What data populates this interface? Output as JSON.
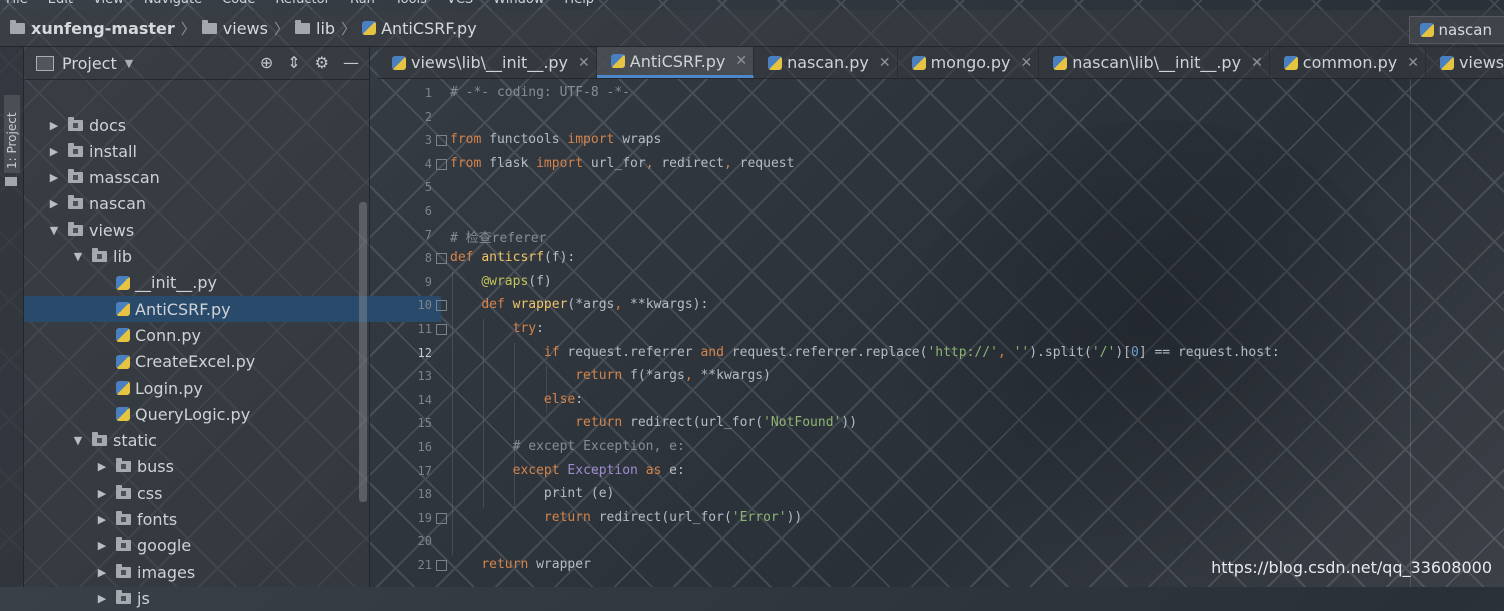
{
  "menu": [
    "File",
    "Edit",
    "View",
    "Navigate",
    "Code",
    "Refactor",
    "Run",
    "Tools",
    "VCS",
    "Window",
    "Help"
  ],
  "breadcrumb": [
    "xunfeng-master",
    "views",
    "lib",
    "AntiCSRF.py"
  ],
  "run_config": "nascan",
  "toolwindow_label": "1: Project",
  "project_panel": {
    "title": "Project"
  },
  "tree": [
    {
      "label": "docs",
      "type": "folder",
      "depth": 1,
      "state": "collapsed"
    },
    {
      "label": "install",
      "type": "folder",
      "depth": 1,
      "state": "collapsed"
    },
    {
      "label": "masscan",
      "type": "folder",
      "depth": 1,
      "state": "collapsed"
    },
    {
      "label": "nascan",
      "type": "folder",
      "depth": 1,
      "state": "collapsed"
    },
    {
      "label": "views",
      "type": "folder",
      "depth": 1,
      "state": "expanded"
    },
    {
      "label": "lib",
      "type": "folder",
      "depth": 2,
      "state": "expanded"
    },
    {
      "label": "__init__.py",
      "type": "file",
      "depth": 3
    },
    {
      "label": "AntiCSRF.py",
      "type": "file",
      "depth": 3,
      "selected": true
    },
    {
      "label": "Conn.py",
      "type": "file",
      "depth": 3
    },
    {
      "label": "CreateExcel.py",
      "type": "file",
      "depth": 3
    },
    {
      "label": "Login.py",
      "type": "file",
      "depth": 3
    },
    {
      "label": "QueryLogic.py",
      "type": "file",
      "depth": 3
    },
    {
      "label": "static",
      "type": "folder",
      "depth": 2,
      "state": "expanded"
    },
    {
      "label": "buss",
      "type": "folder",
      "depth": 3,
      "state": "collapsed"
    },
    {
      "label": "css",
      "type": "folder",
      "depth": 3,
      "state": "collapsed"
    },
    {
      "label": "fonts",
      "type": "folder",
      "depth": 3,
      "state": "collapsed"
    },
    {
      "label": "google",
      "type": "folder",
      "depth": 3,
      "state": "collapsed"
    },
    {
      "label": "images",
      "type": "folder",
      "depth": 3,
      "state": "collapsed"
    },
    {
      "label": "js",
      "type": "folder",
      "depth": 3,
      "state": "collapsed"
    }
  ],
  "tabs": [
    {
      "label": "views\\lib\\__init__.py",
      "active": false
    },
    {
      "label": "AntiCSRF.py",
      "active": true
    },
    {
      "label": "nascan.py",
      "active": false
    },
    {
      "label": "mongo.py",
      "active": false
    },
    {
      "label": "nascan\\lib\\__init__.py",
      "active": false
    },
    {
      "label": "common.py",
      "active": false
    },
    {
      "label": "views\\__init__...",
      "active": false
    }
  ],
  "editor": {
    "current_line": 12,
    "lines": [
      [
        [
          "cmt",
          "# -*- coding: UTF-8 -*-"
        ]
      ],
      [],
      [
        [
          "kw",
          "from"
        ],
        [
          "",
          " functools "
        ],
        [
          "kw",
          "import"
        ],
        [
          "",
          " wraps"
        ]
      ],
      [
        [
          "kw",
          "from"
        ],
        [
          "",
          " flask "
        ],
        [
          "kw",
          "import"
        ],
        [
          "",
          " url_for"
        ],
        [
          "kw",
          ","
        ],
        [
          "",
          " redirect"
        ],
        [
          "kw",
          ","
        ],
        [
          "",
          " request"
        ]
      ],
      [],
      [],
      [
        [
          "cmt",
          "# 检查referer"
        ]
      ],
      [
        [
          "kw",
          "def "
        ],
        [
          "fn",
          "anticsrf"
        ],
        [
          "",
          "(f):"
        ]
      ],
      [
        [
          "",
          "    "
        ],
        [
          "dec",
          "@wraps"
        ],
        [
          "",
          "(f)"
        ]
      ],
      [
        [
          "",
          "    "
        ],
        [
          "kw",
          "def "
        ],
        [
          "fn",
          "wrapper"
        ],
        [
          "",
          "(*args"
        ],
        [
          "kw",
          ","
        ],
        [
          "",
          " **kwargs):"
        ]
      ],
      [
        [
          "",
          "        "
        ],
        [
          "kw",
          "try"
        ],
        [
          "",
          ":"
        ]
      ],
      [
        [
          "",
          "            "
        ],
        [
          "kw",
          "if"
        ],
        [
          "",
          " request.referrer "
        ],
        [
          "kw",
          "and"
        ],
        [
          "",
          " request.referrer.replace("
        ],
        [
          "str",
          "'http://'"
        ],
        [
          "kw",
          ", "
        ],
        [
          "str",
          "''"
        ],
        [
          "",
          ").split("
        ],
        [
          "str",
          "'/'"
        ],
        [
          "",
          ")["
        ],
        [
          "num",
          "0"
        ],
        [
          "",
          "] == request.host:"
        ]
      ],
      [
        [
          "",
          "                "
        ],
        [
          "kw",
          "return"
        ],
        [
          "",
          " f(*args"
        ],
        [
          "kw",
          ","
        ],
        [
          "",
          " **kwargs)"
        ]
      ],
      [
        [
          "",
          "            "
        ],
        [
          "kw",
          "else"
        ],
        [
          "",
          ":"
        ]
      ],
      [
        [
          "",
          "                "
        ],
        [
          "kw",
          "return"
        ],
        [
          "",
          " redirect(url_for("
        ],
        [
          "str",
          "'NotFound'"
        ],
        [
          "",
          "))"
        ]
      ],
      [
        [
          "",
          "        "
        ],
        [
          "cmt",
          "# except Exception, e:"
        ]
      ],
      [
        [
          "",
          "        "
        ],
        [
          "kw",
          "except "
        ],
        [
          "cls",
          "Exception "
        ],
        [
          "kw",
          "as"
        ],
        [
          "",
          " e:"
        ]
      ],
      [
        [
          "",
          "            "
        ],
        [
          "",
          "print"
        ],
        [
          "",
          " (e)"
        ]
      ],
      [
        [
          "",
          "            "
        ],
        [
          "kw",
          "return"
        ],
        [
          "",
          " redirect(url_for("
        ],
        [
          "str",
          "'Error'"
        ],
        [
          "",
          "))"
        ]
      ],
      [],
      [
        [
          "",
          "    "
        ],
        [
          "kw",
          "return"
        ],
        [
          "",
          " wrapper"
        ]
      ]
    ]
  },
  "watermark": "https://blog.csdn.net/qq_33608000"
}
